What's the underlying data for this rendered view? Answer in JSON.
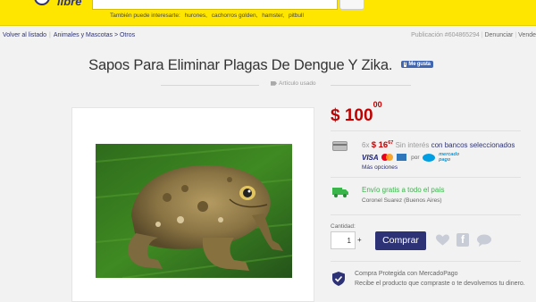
{
  "header": {
    "logo_text": "libre",
    "suggestions_intro": "También puede interesarte:",
    "suggestions": [
      "hurones,",
      "cachorros golden,",
      "hamster,",
      "pitbull"
    ]
  },
  "breadcrumb": {
    "back": "Volver al listado",
    "category": "Animales y Mascotas > Otros"
  },
  "publication": {
    "id_text": "Publicación #604865294",
    "report": "Denunciar",
    "sell": "Vende"
  },
  "product": {
    "title": "Sapos Para Eliminar Plagas De Dengue Y Zika.",
    "fb_like": "Me gusta",
    "condition": "Artículo usado"
  },
  "price": {
    "currency": "$",
    "whole": "100",
    "cents": "00"
  },
  "payment": {
    "installments": "6x",
    "installment_currency": "$",
    "installment_whole": "16",
    "installment_cents": "67",
    "no_interest": "Sin interés",
    "banks_link": "con bancos seleccionados",
    "cards_visa": "VISA",
    "por": "por",
    "mp_line1": "mercado",
    "mp_line2": "pago",
    "more_options": "Más opciones"
  },
  "shipping": {
    "text": "Envío gratis a todo el país",
    "location": "Coronel Suarez (Buenos Aires)"
  },
  "purchase": {
    "qty_label": "Cantidad:",
    "qty_value": "1",
    "plus": "+",
    "buy_label": "Comprar"
  },
  "protection": {
    "title": "Compra Protegida con MercadoPago",
    "desc": "Recibe el producto que compraste o te devolvemos tu dinero."
  },
  "icons": {
    "card": "credit-card-icon",
    "truck": "truck-icon",
    "heart": "heart-icon",
    "facebook": "facebook-icon",
    "comment": "comment-icon",
    "shield": "shield-icon"
  },
  "colors": {
    "brand_yellow": "#ffe600",
    "brand_blue": "#2d3277",
    "price_red": "#c20000",
    "shipping_green": "#39b54a"
  }
}
